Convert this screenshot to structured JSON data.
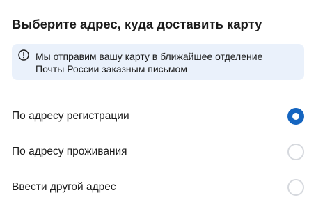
{
  "screen": {
    "title": "Выберите адрес, куда доставить карту"
  },
  "info": {
    "icon": "info-circle-icon",
    "line1": "Мы отправим вашу карту в ближайшее отделение",
    "line2": "Почты России заказным письмом",
    "background_color": "#eaf1fb"
  },
  "options": [
    {
      "label": "По адресу регистрации",
      "selected": true
    },
    {
      "label": "По адресу проживания",
      "selected": false
    },
    {
      "label": "Ввести другой адрес",
      "selected": false
    }
  ],
  "colors": {
    "accent": "#1565c0",
    "radio_unselected": "#d6d9de"
  }
}
